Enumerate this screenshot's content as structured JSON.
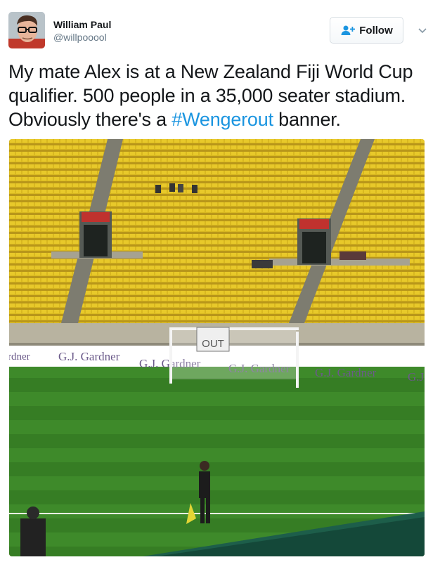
{
  "user": {
    "display_name": "William Paul",
    "handle": "@willpooool",
    "avatar_icon": "avatar-photo"
  },
  "follow_button": {
    "label": "Follow",
    "icon": "add-user-icon"
  },
  "menu_icon": "chevron-down-icon",
  "tweet": {
    "text_before": "My mate Alex is at a New Zealand Fiji World Cup qualifier. 500 people in a 35,000 seater stadium. Obviously there's a ",
    "hashtag": "#Wengerout",
    "text_after": " banner."
  },
  "photo": {
    "banner_text": "OUT",
    "hoarding_text": "G.J. Gardner",
    "partial_left": "rdner",
    "partial_right": "G.J"
  },
  "colors": {
    "accent": "#1b95e0",
    "text": "#14171a",
    "muted": "#657786"
  }
}
